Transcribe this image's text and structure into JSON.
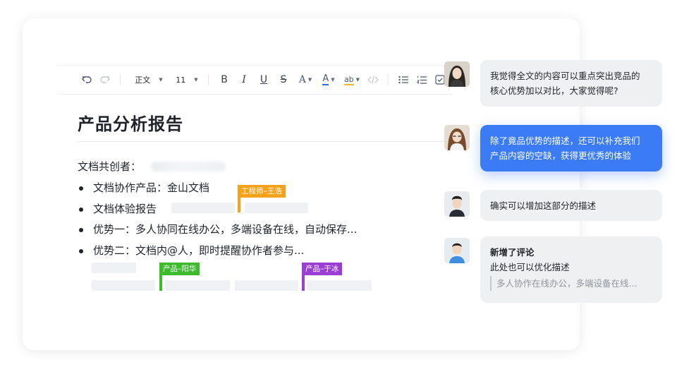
{
  "toolbar": {
    "undo_icon": "undo-icon",
    "redo_icon": "redo-icon",
    "paragraph_style": "正文",
    "font_size": "11",
    "bold": "B",
    "italic": "I",
    "underline": "U",
    "strikethrough": "S",
    "font_size_adjust": "A",
    "text_color": "A",
    "highlight": "ab",
    "code_icon": "code-icon",
    "bullet_list_icon": "bullet-list-icon",
    "numbered_list_icon": "numbered-list-icon",
    "checkbox_icon": "checkbox-icon",
    "text_color_underline": "#2b6cf0",
    "highlight_underline": "#f5b33b"
  },
  "document": {
    "title": "产品分析报告",
    "coauthor_label": "文档共创者：",
    "bullets": [
      "文档协作产品：金山文档",
      "文档体验报告",
      "优势一：多人协同在线办公，多端设备在线，自动保存...",
      "优势二：文档内@人，即时提醒协作者参与..."
    ]
  },
  "cursors": [
    {
      "label": "工程师–王浩",
      "color": "#f5a21b"
    },
    {
      "label": "产品–阳华",
      "color": "#3cbc2c"
    },
    {
      "label": "产品–于冰",
      "color": "#9b3fd4"
    }
  ],
  "comments": [
    {
      "text_line1": "我觉得全文的内容可以重点突出竞品的",
      "text_line2": "核心优势加以对比，大家觉得呢?"
    },
    {
      "text_line1": "除了竟品优势的描述，还可以补充我们",
      "text_line2": "产品内容的空缺，获得更优秀的体验"
    },
    {
      "text_line1": "确实可以增加这部分的描述"
    },
    {
      "title": "新增了评论",
      "text_line1": "此处也可以优化描述",
      "quote": "多人协作在线办公，多端设备在线..."
    }
  ],
  "colors": {
    "active_comment_bg": "#3b7bf6",
    "comment_bg": "#eff0f1"
  }
}
